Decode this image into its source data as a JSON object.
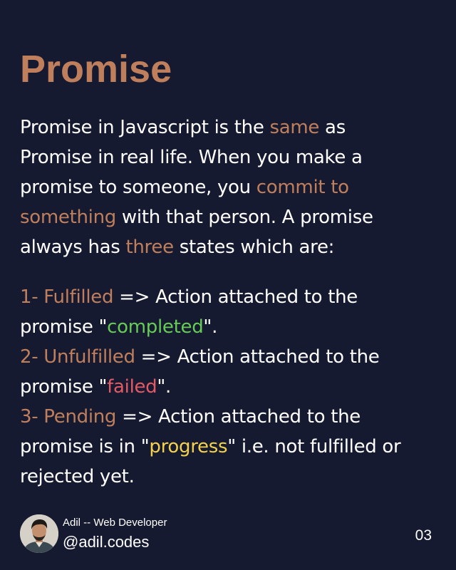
{
  "title": "Promise",
  "intro": {
    "l1a": "Promise in Javascript is the ",
    "l1b": "same",
    "l1c": " as",
    "l2": "Promise in real life. When you make a",
    "l3a": "promise to someone, you ",
    "l3b": "commit to",
    "l4a": "something",
    "l4b": " with that person. A promise",
    "l5a": "always has ",
    "l5b": "three",
    "l5c": " states which are:"
  },
  "states": [
    {
      "num": "1-",
      "name": "Fulfilled",
      "desc": " => Action attached to the",
      "pre": "promise \"",
      "word": "completed",
      "post": "\".",
      "color": "#66cc55"
    },
    {
      "num": "2-",
      "name": "Unfulfilled",
      "desc": " => Action attached to the",
      "pre": "promise \"",
      "word": "failed",
      "post": "\".",
      "color": "#e35a64"
    },
    {
      "num": "3-",
      "name": "Pending",
      "desc": " => Action attached to the",
      "pre": "promise is in \"",
      "word": "progress",
      "post": "\" i.e. not fulfilled or",
      "extra": "rejected yet.",
      "color": "#f2d24d"
    }
  ],
  "footer": {
    "author": "Adil -- Web Developer",
    "handle": "@adil.codes",
    "page": "03"
  },
  "colors": {
    "background": "#161a30",
    "accent": "#c07f5c"
  }
}
